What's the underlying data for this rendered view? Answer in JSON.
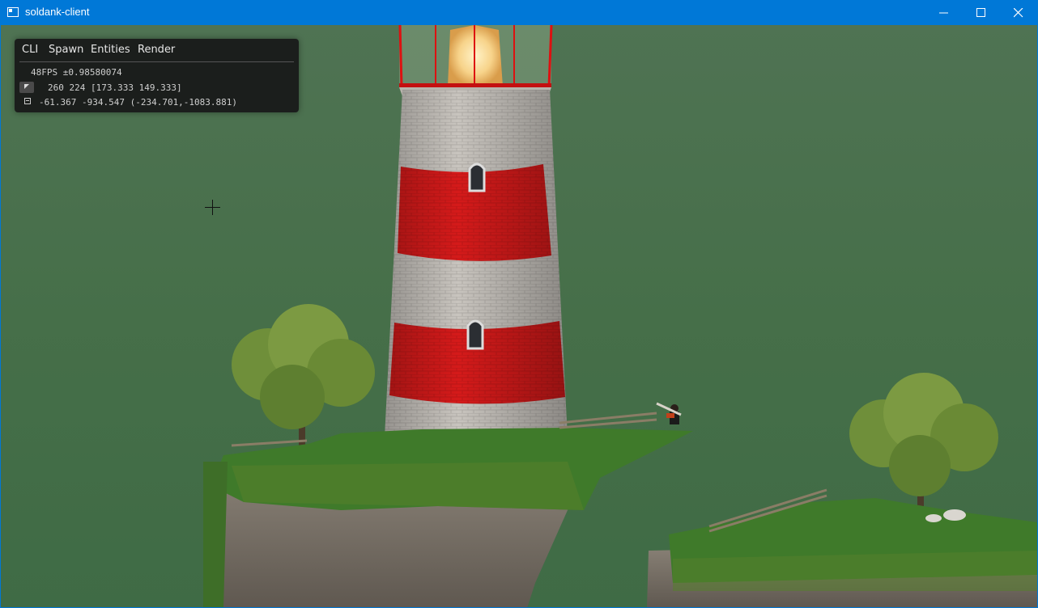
{
  "window": {
    "title": "soldank-client",
    "accent_color": "#0078d7",
    "icons": [
      "app-icon",
      "minimize-icon",
      "maximize-icon",
      "close-icon"
    ]
  },
  "debug": {
    "menu": [
      "CLI",
      "Spawn",
      "Entities",
      "Render"
    ],
    "fps_line": "48FPS ±0.98580074",
    "cursor_line": "260 224 [173.333 149.333]",
    "world_line": "-61.367 -934.547 (-234.701,-1083.881)",
    "icons": [
      "cursor-icon",
      "world-icon"
    ]
  },
  "scene": {
    "sky_color": "#466f49",
    "objects": [
      "lighthouse",
      "cliff-main",
      "cliff-right",
      "tree-left",
      "tree-right",
      "soldier",
      "sheep",
      "fence"
    ]
  }
}
